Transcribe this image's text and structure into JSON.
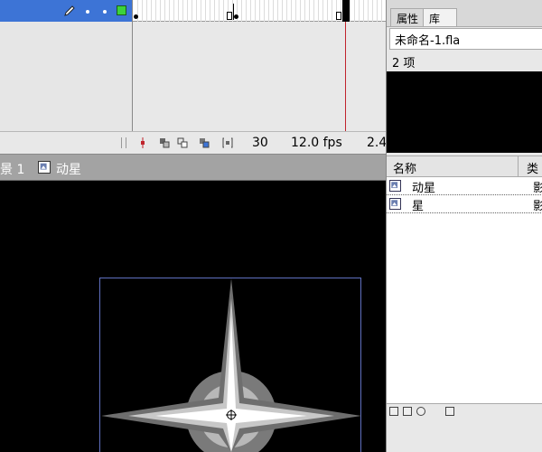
{
  "timeline": {
    "current_frame": "30",
    "frame_rate": "12.0 fps",
    "elapsed_time": "2.4"
  },
  "scene_bar": {
    "scene_label": "景 1",
    "symbol_label": "动星"
  },
  "panel": {
    "tabs": [
      {
        "label": "属性",
        "active": false
      },
      {
        "label": "库",
        "active": true
      }
    ],
    "tab_close": "×",
    "file_name": "未命名-1.fla",
    "item_count": "2 项",
    "columns": {
      "name": "名称",
      "type": "类"
    },
    "items": [
      {
        "name": "动星",
        "type": "影"
      },
      {
        "name": "星",
        "type": "影"
      }
    ]
  },
  "colors": {
    "layer_highlight": "#3d74d6",
    "layer_color": "#3cd23c",
    "playhead": "#c0242c",
    "stage_bg": "#000000"
  }
}
